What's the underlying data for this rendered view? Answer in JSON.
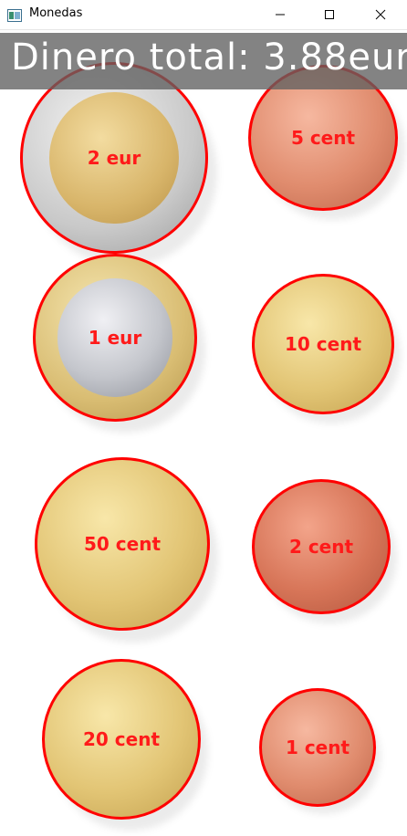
{
  "window": {
    "title": "Monedas",
    "controls": [
      "minimize",
      "maximize",
      "close"
    ]
  },
  "banner": {
    "text": "Dinero total: 3.88eur"
  },
  "coins": [
    {
      "label": "2 eur"
    },
    {
      "label": "5 cent"
    },
    {
      "label": "1 eur"
    },
    {
      "label": "10 cent"
    },
    {
      "label": "50 cent"
    },
    {
      "label": "2 cent"
    },
    {
      "label": "20 cent"
    },
    {
      "label": "1 cent"
    }
  ],
  "colors": {
    "detection_ring": "#ff0000",
    "label_text": "#ff1a1a",
    "banner_bg": "#606060",
    "banner_text": "#ffffff"
  }
}
